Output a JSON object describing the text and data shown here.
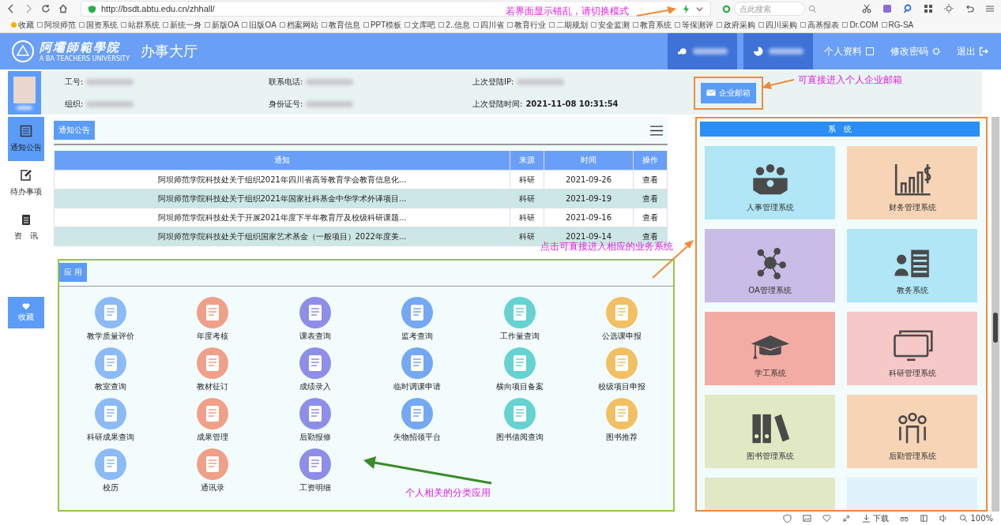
{
  "browser": {
    "url": "http://bsdt.abtu.edu.cn/zhhall/",
    "search": {
      "placeholder": "点此搜索"
    },
    "bookmarks": [
      "收藏",
      "阿坝师范",
      "国资系统",
      "站群系统",
      "新统一身",
      "新版OA",
      "旧版OA",
      "档案网站",
      "教育信息",
      "PPT模板",
      "文库吧",
      "2..信息",
      "四川省",
      "教育行业",
      "二期规划",
      "安全监测",
      "教育系统",
      "等保测评",
      "政府采购",
      "四川采购",
      "高基报表",
      "Dr.COM",
      "RG-SA"
    ]
  },
  "header": {
    "logo_name": "阿壩師範學院",
    "logo_subtitle": "A BA TEACHERS UNIVERSITY",
    "title": "办事大厅",
    "nav": [
      {
        "label": "个人资料"
      },
      {
        "label": "修改密码"
      },
      {
        "label": "退出"
      }
    ]
  },
  "profile": {
    "fields": [
      {
        "label": "工号:"
      },
      {
        "label": "联系电话:"
      },
      {
        "label": "上次登陆IP:"
      },
      {
        "label": "组织:"
      },
      {
        "label": "身份证号:"
      },
      {
        "label": "上次登陆时间:",
        "value": "2021-11-08 10:31:54"
      }
    ],
    "mail_button": "企业邮箱"
  },
  "sidebar": {
    "items": [
      {
        "label": "通知公告",
        "selected": true
      },
      {
        "label": "待办事项",
        "selected": false
      },
      {
        "label": "资　讯",
        "selected": false
      }
    ],
    "favorite": "收藏"
  },
  "notices": {
    "tab": "通知公告",
    "columns": [
      "通知",
      "来源",
      "时间",
      "操作"
    ],
    "rows": [
      {
        "title": "阿坝师范学院科技处关于组织2021年四川省高等教育学会教育信息化...",
        "source": "科研",
        "date": "2021-09-26",
        "action": "查看"
      },
      {
        "title": "阿坝师范学院科技处关于组织2021年国家社科基金中华学术外译项目...",
        "source": "科研",
        "date": "2021-09-19",
        "action": "查看"
      },
      {
        "title": "阿坝师范学院科技处关于开展2021年度下半年教育厅及校级科研课题...",
        "source": "科研",
        "date": "2021-09-16",
        "action": "查看"
      },
      {
        "title": "阿坝师范学院科技处关于组织国家艺术基金（一般项目）2022年度美...",
        "source": "科研",
        "date": "2021-09-14",
        "action": "查看"
      }
    ]
  },
  "apps": {
    "tab": "应 用",
    "items": [
      {
        "label": "教学质量评价",
        "color": "#8cbaf7"
      },
      {
        "label": "年度考核",
        "color": "#f0a088"
      },
      {
        "label": "课表查询",
        "color": "#8e8ee8"
      },
      {
        "label": "监考查询",
        "color": "#74a8f2"
      },
      {
        "label": "工作量查询",
        "color": "#66d2d2"
      },
      {
        "label": "公选课申报",
        "color": "#f2c062"
      },
      {
        "label": "教室查询",
        "color": "#8cbaf7"
      },
      {
        "label": "教材征订",
        "color": "#f0a088"
      },
      {
        "label": "成绩录入",
        "color": "#8e8ee8"
      },
      {
        "label": "临时调课申请",
        "color": "#74a8f2"
      },
      {
        "label": "横向项目备案",
        "color": "#66d2d2"
      },
      {
        "label": "校级项目申报",
        "color": "#f2c062"
      },
      {
        "label": "科研成果查询",
        "color": "#8cbaf7"
      },
      {
        "label": "成果管理",
        "color": "#f0a088"
      },
      {
        "label": "后勤报修",
        "color": "#8e8ee8"
      },
      {
        "label": "失物招领平台",
        "color": "#74a8f2"
      },
      {
        "label": "图书借阅查询",
        "color": "#66d2d2"
      },
      {
        "label": "图书推荐",
        "color": "#f2c062"
      },
      {
        "label": "校历",
        "color": "#8cbaf7"
      },
      {
        "label": "通讯录",
        "color": "#f0a088"
      },
      {
        "label": "工资明细",
        "color": "#8e8ee8"
      }
    ]
  },
  "systems": {
    "title": "系　统",
    "items": [
      {
        "label": "人事管理系统",
        "color": "#b0e6f6"
      },
      {
        "label": "财务管理系统",
        "color": "#f7d4b6"
      },
      {
        "label": "OA管理系统",
        "color": "#c9bce6"
      },
      {
        "label": "教务系统",
        "color": "#b0e6f6"
      },
      {
        "label": "学工系统",
        "color": "#f2aca4"
      },
      {
        "label": "科研管理系统",
        "color": "#f6c8c8"
      },
      {
        "label": "图书管理系统",
        "color": "#dfeac4"
      },
      {
        "label": "后勤管理系统",
        "color": "#f7d4b6"
      },
      {
        "color": "#dfeac4"
      },
      {
        "color": "#dff2fa"
      }
    ]
  },
  "annotations": [
    "若界面显示错乱，请切换模式",
    "可直接进入个人企业邮箱",
    "点击可直接进入相应的业务系统",
    "个人相关的分类应用"
  ],
  "status_bar": {
    "download": "下载",
    "zoom": "100%"
  }
}
